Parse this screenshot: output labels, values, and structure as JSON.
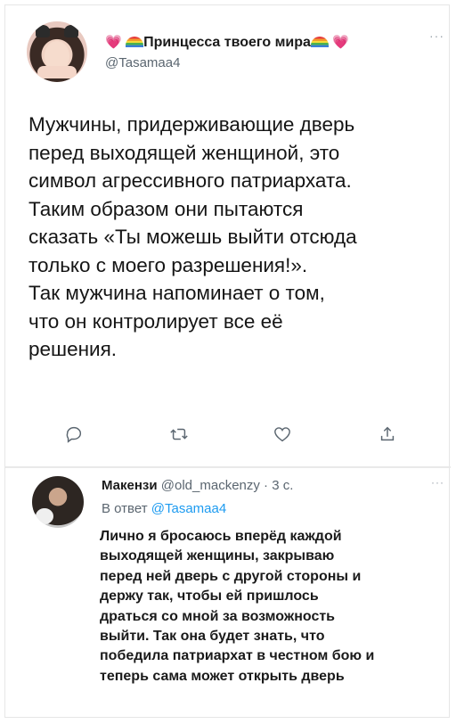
{
  "tweet": {
    "display_name": "Принцесса твоего мира",
    "heart": "💗",
    "handle": "@Tasamaa4",
    "more": "···",
    "text_lines": [
      "Мужчины, придерживающие дверь",
      "перед выходящей женщиной, это",
      "символ агрессивного патриархата.",
      "Таким образом они пытаются",
      "сказать «Ты можешь выйти отсюда",
      "только с моего разрешения!».",
      "Так мужчина напоминает о том,",
      "что он контролирует все её",
      "решения."
    ],
    "actions": [
      {
        "name": "reply-icon"
      },
      {
        "name": "retweet-icon"
      },
      {
        "name": "like-icon"
      },
      {
        "name": "share-icon"
      }
    ]
  },
  "reply": {
    "display_name": "Макензи",
    "meta": "@old_mackenzy · 3 с.",
    "more": "···",
    "replying_prefix": "В ответ",
    "replying_to": "@Tasamaa4",
    "text_lines": [
      "Лично я бросаюсь вперёд каждой",
      "выходящей женщины, закрываю",
      "перед ней дверь с другой стороны и",
      "держу так, чтобы ей пришлось",
      "драться со мной за возможность",
      "выйти. Так она будет знать, что",
      "победила патриархат в честном бою и",
      "теперь сама может открыть дверь"
    ]
  },
  "colors": {
    "link": "#1d9bf0",
    "muted": "#5b6670",
    "heart": "#e0529c"
  }
}
